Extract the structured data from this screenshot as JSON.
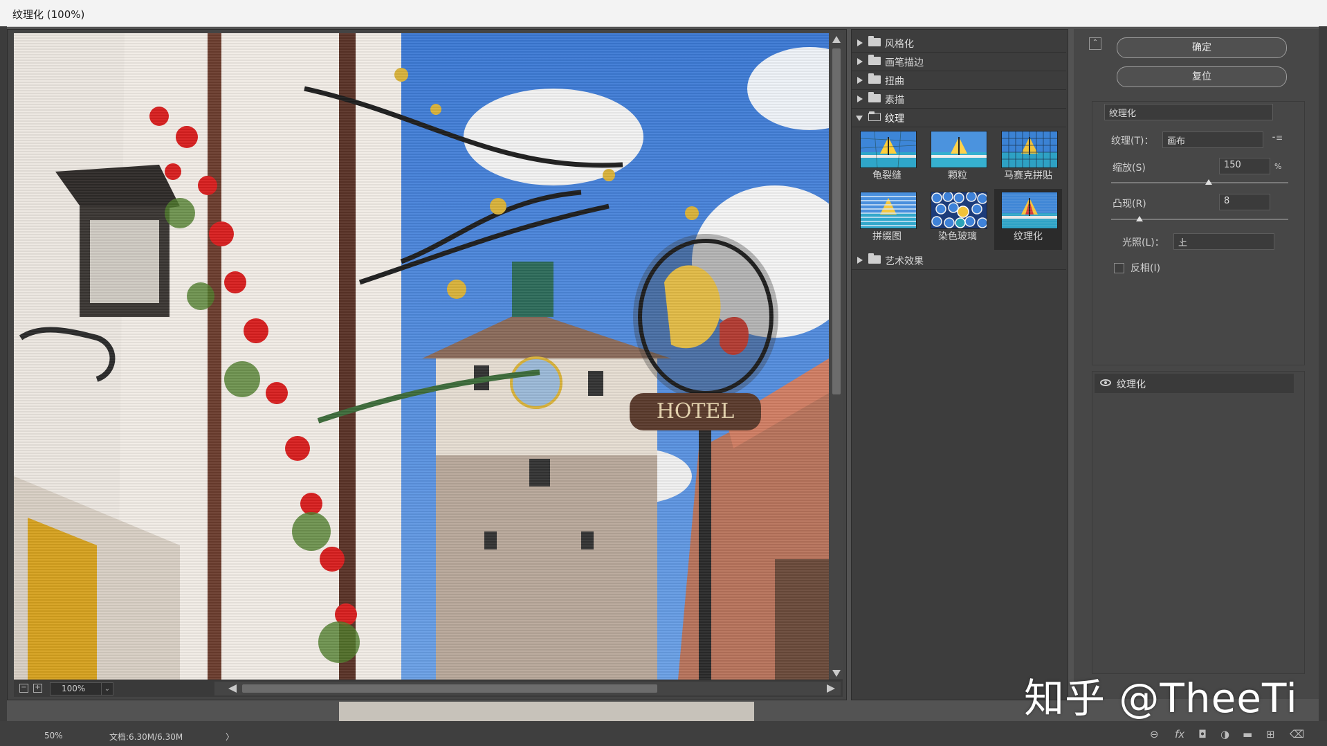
{
  "title": "纹理化 (100%)",
  "preview": {
    "zoom": "100%"
  },
  "gallery": {
    "categories_top": [
      "风格化",
      "画笔描边",
      "扭曲",
      "素描"
    ],
    "open_category": "纹理",
    "filters": [
      "龟裂缝",
      "颗粒",
      "马赛克拼贴",
      "拼缀图",
      "染色玻璃",
      "纹理化"
    ],
    "selected_filter": "纹理化",
    "categories_bottom": [
      "艺术效果"
    ]
  },
  "settings": {
    "ok_label": "确定",
    "reset_label": "复位",
    "filter_select": "纹理化",
    "texture_label": "纹理(T)：",
    "texture_value": "画布",
    "scale_label": "缩放(S)",
    "scale_value": "150",
    "scale_unit": "%",
    "scale_fraction": 0.55,
    "relief_label": "凸现(R)",
    "relief_value": "8",
    "relief_fraction": 0.16,
    "light_label": "光照(L)：",
    "light_value": "上",
    "invert_label": "反相(I)",
    "invert_checked": false
  },
  "layers": {
    "row_label": "纹理化"
  },
  "status": {
    "zoom": "50%",
    "doc": "文档:6.30M/6.30M",
    "arrow": "〉"
  },
  "watermark": "知乎 @TheeTi",
  "colors": {
    "dialog_bg": "#474747",
    "gallery_bg": "#3d3d3d",
    "titlebar_bg": "#f3f3f3"
  }
}
